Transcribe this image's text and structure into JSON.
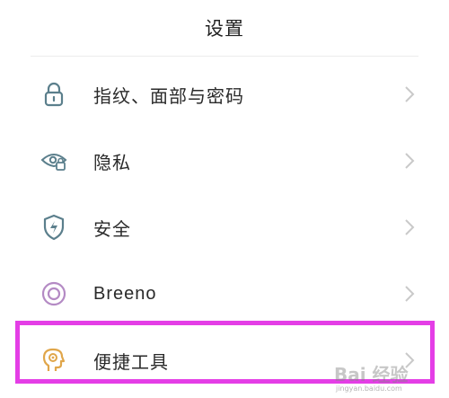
{
  "header": {
    "title": "设置"
  },
  "settings": {
    "items": [
      {
        "label": "指纹、面部与密码",
        "icon": "lock-icon"
      },
      {
        "label": "隐私",
        "icon": "privacy-eye-icon"
      },
      {
        "label": "安全",
        "icon": "shield-icon"
      },
      {
        "label": "Breeno",
        "icon": "breeno-icon"
      },
      {
        "label": "便捷工具",
        "icon": "convenience-tools-icon"
      }
    ]
  },
  "colors": {
    "highlight": "#e43ee6",
    "icon_teal": "#5b7f8c",
    "icon_purple": "#b48ac4",
    "icon_orange": "#e0a64a"
  },
  "watermark": {
    "main": "Bai 经验",
    "sub": "jingyan.baidu.com"
  }
}
